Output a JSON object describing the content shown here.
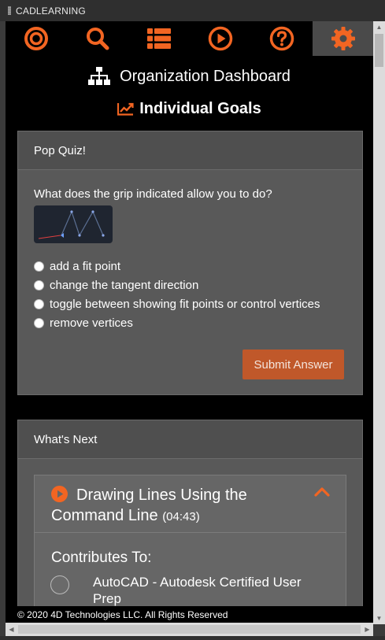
{
  "window": {
    "title": "CADLEARNING"
  },
  "nav": {
    "items": [
      {
        "icon": "target-icon",
        "active": false
      },
      {
        "icon": "search-icon",
        "active": false
      },
      {
        "icon": "list-icon",
        "active": false
      },
      {
        "icon": "play-icon",
        "active": false
      },
      {
        "icon": "help-icon",
        "active": false
      },
      {
        "icon": "gear-icon",
        "active": true
      }
    ],
    "accent_color": "#f26522"
  },
  "header": {
    "org_title": "Organization Dashboard",
    "goals_title": "Individual Goals"
  },
  "quiz": {
    "heading": "Pop Quiz!",
    "question": "What does the grip indicated allow you to do?",
    "options": [
      "add a fit point",
      "change the tangent direction",
      "toggle between showing fit points or control vertices",
      "remove vertices"
    ],
    "submit_label": "Submit Answer"
  },
  "whats_next": {
    "heading": "What's Next",
    "lesson": {
      "title": "Drawing Lines Using the Command Line",
      "duration": "(04:43)",
      "contributes_label": "Contributes To:",
      "certification": "AutoCAD - Autodesk Certified User Prep"
    }
  },
  "footer": {
    "text": "© 2020 4D Technologies LLC. All Rights Reserved"
  },
  "colors": {
    "accent": "#f26522",
    "submit_button": "#c0582a",
    "card": "#595959"
  }
}
